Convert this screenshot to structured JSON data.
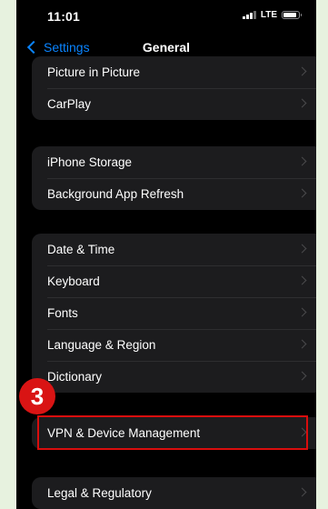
{
  "status_bar": {
    "time": "11:01",
    "network": "LTE"
  },
  "nav": {
    "back_label": "Settings",
    "title": "General"
  },
  "groups": [
    {
      "items": [
        {
          "label": "Picture in Picture"
        },
        {
          "label": "CarPlay"
        }
      ]
    },
    {
      "items": [
        {
          "label": "iPhone Storage"
        },
        {
          "label": "Background App Refresh"
        }
      ]
    },
    {
      "items": [
        {
          "label": "Date & Time"
        },
        {
          "label": "Keyboard"
        },
        {
          "label": "Fonts"
        },
        {
          "label": "Language & Region"
        },
        {
          "label": "Dictionary"
        }
      ]
    },
    {
      "items": [
        {
          "label": "VPN & Device Management"
        }
      ]
    },
    {
      "items": [
        {
          "label": "Legal & Regulatory"
        }
      ]
    }
  ],
  "annotation": {
    "step_number": "3",
    "highlight_color": "#d90d0d"
  },
  "colors": {
    "accent": "#0a84ff",
    "background": "#000000",
    "group_background": "#1c1c1e",
    "outer_background": "#e7f2df"
  }
}
